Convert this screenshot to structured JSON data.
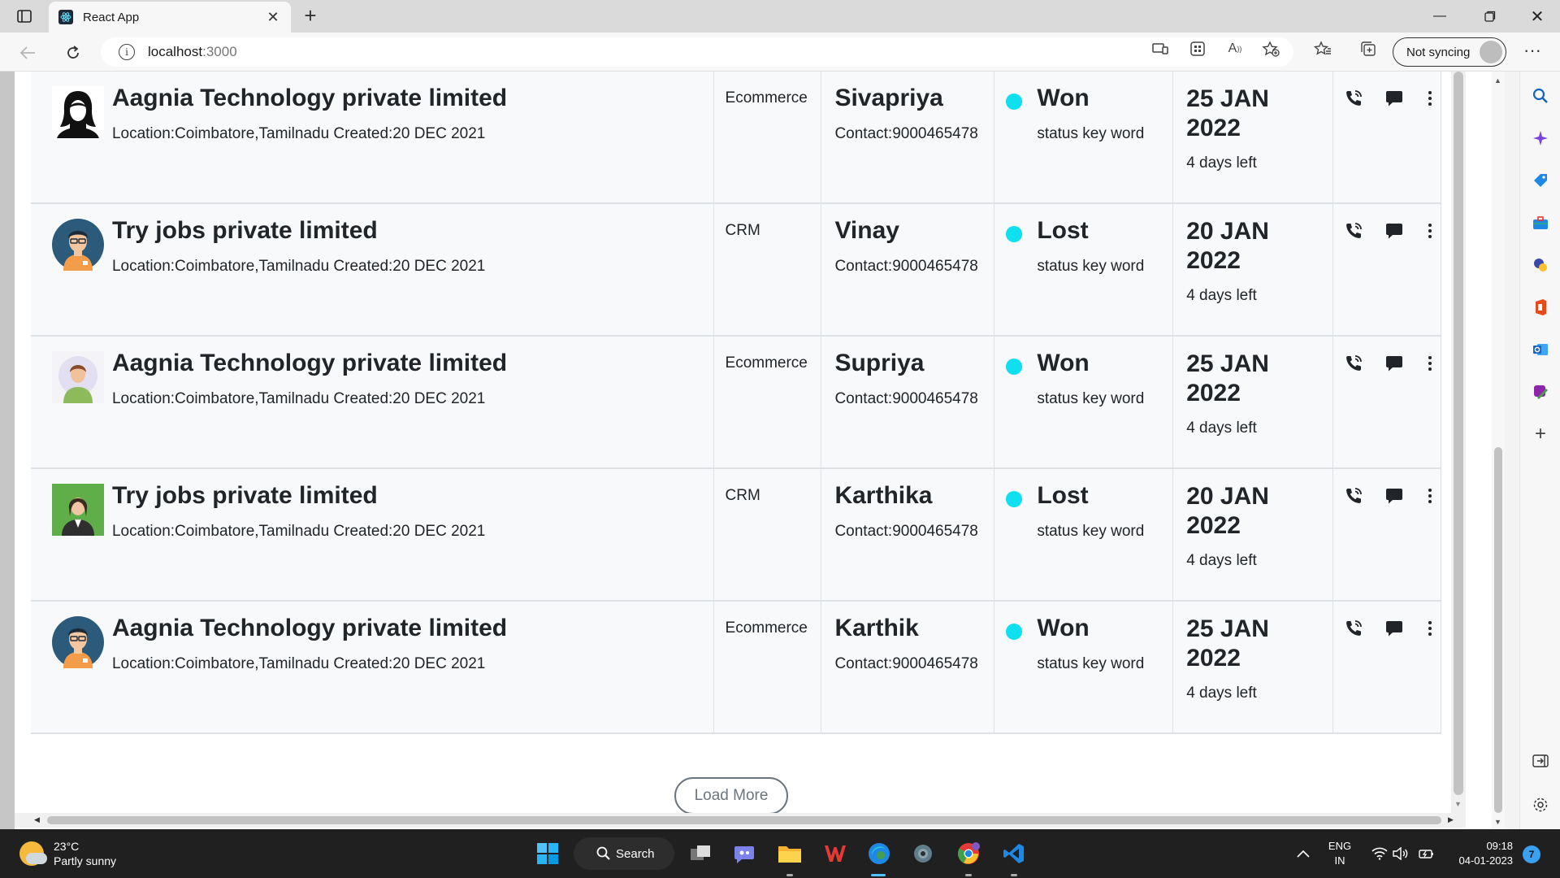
{
  "browser": {
    "tab_title": "React App",
    "url_host": "localhost",
    "url_port": ":3000",
    "sync_label": "Not syncing"
  },
  "rows": [
    {
      "company": "Aagnia Technology private limited",
      "meta": "Location:Coimbatore,Tamilnadu Created:20 DEC 2021",
      "category": "Ecommerce",
      "person": "Sivapriya",
      "contact": "Contact:9000465478",
      "status": "Won",
      "status_kw": "status key word",
      "date": "25 JAN 2022",
      "days_left": "4 days left",
      "avatar": "woman-silhouette-avatar"
    },
    {
      "company": "Try jobs private limited",
      "meta": "Location:Coimbatore,Tamilnadu Created:20 DEC 2021",
      "category": "CRM",
      "person": "Vinay",
      "contact": "Contact:9000465478",
      "status": "Lost",
      "status_kw": "status key word",
      "date": "20 JAN 2022",
      "days_left": "4 days left",
      "avatar": "man-glasses-avatar"
    },
    {
      "company": "Aagnia Technology private limited",
      "meta": "Location:Coimbatore,Tamilnadu Created:20 DEC 2021",
      "category": "Ecommerce",
      "person": "Supriya",
      "contact": "Contact:9000465478",
      "status": "Won",
      "status_kw": "status key word",
      "date": "25 JAN 2022",
      "days_left": "4 days left",
      "avatar": "woman-green-avatar"
    },
    {
      "company": "Try jobs private limited",
      "meta": "Location:Coimbatore,Tamilnadu Created:20 DEC 2021",
      "category": "CRM",
      "person": "Karthika",
      "contact": "Contact:9000465478",
      "status": "Lost",
      "status_kw": "status key word",
      "date": "20 JAN 2022",
      "days_left": "4 days left",
      "avatar": "woman-office-avatar"
    },
    {
      "company": "Aagnia Technology private limited",
      "meta": "Location:Coimbatore,Tamilnadu Created:20 DEC 2021",
      "category": "Ecommerce",
      "person": "Karthik",
      "contact": "Contact:9000465478",
      "status": "Won",
      "status_kw": "status key word",
      "date": "25 JAN 2022",
      "days_left": "4 days left",
      "avatar": "man-glasses-avatar"
    }
  ],
  "load_more_label": "Load More",
  "colors": {
    "status_dot": "#0fe0ef",
    "edge_accent": "#1565c0"
  },
  "taskbar": {
    "weather_temp": "23°C",
    "weather_desc": "Partly sunny",
    "search_label": "Search",
    "lang_line1": "ENG",
    "lang_line2": "IN",
    "time": "09:18",
    "date": "04-01-2023",
    "notifications": "7"
  }
}
